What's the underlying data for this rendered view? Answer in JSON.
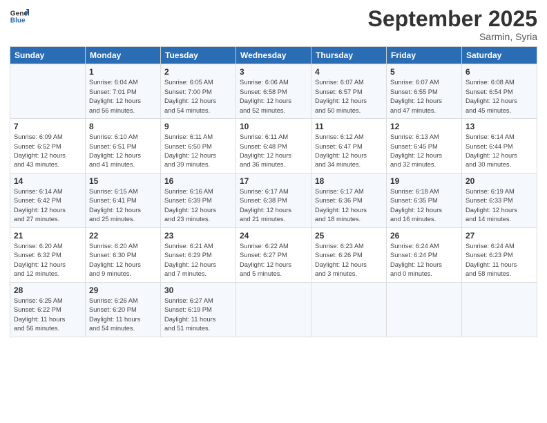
{
  "header": {
    "logo_line1": "General",
    "logo_line2": "Blue",
    "month": "September 2025",
    "location": "Sarmin, Syria"
  },
  "days_of_week": [
    "Sunday",
    "Monday",
    "Tuesday",
    "Wednesday",
    "Thursday",
    "Friday",
    "Saturday"
  ],
  "weeks": [
    [
      {
        "day": "",
        "info": ""
      },
      {
        "day": "1",
        "info": "Sunrise: 6:04 AM\nSunset: 7:01 PM\nDaylight: 12 hours\nand 56 minutes."
      },
      {
        "day": "2",
        "info": "Sunrise: 6:05 AM\nSunset: 7:00 PM\nDaylight: 12 hours\nand 54 minutes."
      },
      {
        "day": "3",
        "info": "Sunrise: 6:06 AM\nSunset: 6:58 PM\nDaylight: 12 hours\nand 52 minutes."
      },
      {
        "day": "4",
        "info": "Sunrise: 6:07 AM\nSunset: 6:57 PM\nDaylight: 12 hours\nand 50 minutes."
      },
      {
        "day": "5",
        "info": "Sunrise: 6:07 AM\nSunset: 6:55 PM\nDaylight: 12 hours\nand 47 minutes."
      },
      {
        "day": "6",
        "info": "Sunrise: 6:08 AM\nSunset: 6:54 PM\nDaylight: 12 hours\nand 45 minutes."
      }
    ],
    [
      {
        "day": "7",
        "info": "Sunrise: 6:09 AM\nSunset: 6:52 PM\nDaylight: 12 hours\nand 43 minutes."
      },
      {
        "day": "8",
        "info": "Sunrise: 6:10 AM\nSunset: 6:51 PM\nDaylight: 12 hours\nand 41 minutes."
      },
      {
        "day": "9",
        "info": "Sunrise: 6:11 AM\nSunset: 6:50 PM\nDaylight: 12 hours\nand 39 minutes."
      },
      {
        "day": "10",
        "info": "Sunrise: 6:11 AM\nSunset: 6:48 PM\nDaylight: 12 hours\nand 36 minutes."
      },
      {
        "day": "11",
        "info": "Sunrise: 6:12 AM\nSunset: 6:47 PM\nDaylight: 12 hours\nand 34 minutes."
      },
      {
        "day": "12",
        "info": "Sunrise: 6:13 AM\nSunset: 6:45 PM\nDaylight: 12 hours\nand 32 minutes."
      },
      {
        "day": "13",
        "info": "Sunrise: 6:14 AM\nSunset: 6:44 PM\nDaylight: 12 hours\nand 30 minutes."
      }
    ],
    [
      {
        "day": "14",
        "info": "Sunrise: 6:14 AM\nSunset: 6:42 PM\nDaylight: 12 hours\nand 27 minutes."
      },
      {
        "day": "15",
        "info": "Sunrise: 6:15 AM\nSunset: 6:41 PM\nDaylight: 12 hours\nand 25 minutes."
      },
      {
        "day": "16",
        "info": "Sunrise: 6:16 AM\nSunset: 6:39 PM\nDaylight: 12 hours\nand 23 minutes."
      },
      {
        "day": "17",
        "info": "Sunrise: 6:17 AM\nSunset: 6:38 PM\nDaylight: 12 hours\nand 21 minutes."
      },
      {
        "day": "18",
        "info": "Sunrise: 6:17 AM\nSunset: 6:36 PM\nDaylight: 12 hours\nand 18 minutes."
      },
      {
        "day": "19",
        "info": "Sunrise: 6:18 AM\nSunset: 6:35 PM\nDaylight: 12 hours\nand 16 minutes."
      },
      {
        "day": "20",
        "info": "Sunrise: 6:19 AM\nSunset: 6:33 PM\nDaylight: 12 hours\nand 14 minutes."
      }
    ],
    [
      {
        "day": "21",
        "info": "Sunrise: 6:20 AM\nSunset: 6:32 PM\nDaylight: 12 hours\nand 12 minutes."
      },
      {
        "day": "22",
        "info": "Sunrise: 6:20 AM\nSunset: 6:30 PM\nDaylight: 12 hours\nand 9 minutes."
      },
      {
        "day": "23",
        "info": "Sunrise: 6:21 AM\nSunset: 6:29 PM\nDaylight: 12 hours\nand 7 minutes."
      },
      {
        "day": "24",
        "info": "Sunrise: 6:22 AM\nSunset: 6:27 PM\nDaylight: 12 hours\nand 5 minutes."
      },
      {
        "day": "25",
        "info": "Sunrise: 6:23 AM\nSunset: 6:26 PM\nDaylight: 12 hours\nand 3 minutes."
      },
      {
        "day": "26",
        "info": "Sunrise: 6:24 AM\nSunset: 6:24 PM\nDaylight: 12 hours\nand 0 minutes."
      },
      {
        "day": "27",
        "info": "Sunrise: 6:24 AM\nSunset: 6:23 PM\nDaylight: 11 hours\nand 58 minutes."
      }
    ],
    [
      {
        "day": "28",
        "info": "Sunrise: 6:25 AM\nSunset: 6:22 PM\nDaylight: 11 hours\nand 56 minutes."
      },
      {
        "day": "29",
        "info": "Sunrise: 6:26 AM\nSunset: 6:20 PM\nDaylight: 11 hours\nand 54 minutes."
      },
      {
        "day": "30",
        "info": "Sunrise: 6:27 AM\nSunset: 6:19 PM\nDaylight: 11 hours\nand 51 minutes."
      },
      {
        "day": "",
        "info": ""
      },
      {
        "day": "",
        "info": ""
      },
      {
        "day": "",
        "info": ""
      },
      {
        "day": "",
        "info": ""
      }
    ]
  ]
}
